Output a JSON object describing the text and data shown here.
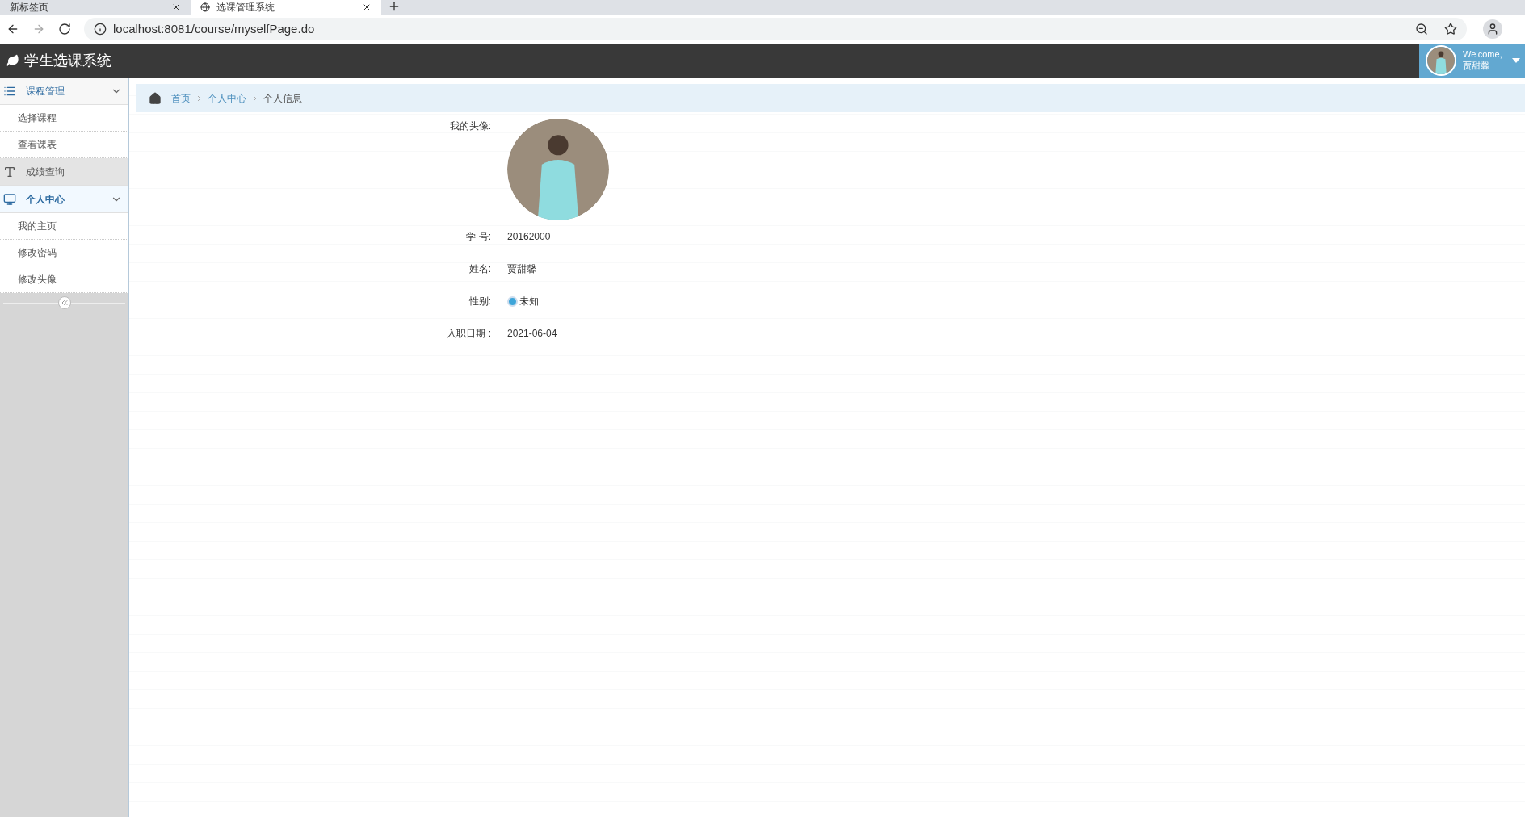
{
  "browser": {
    "tabs": [
      {
        "title": "新标签页",
        "selected": false
      },
      {
        "title": "选课管理系统",
        "selected": true
      }
    ],
    "url": "localhost:8081/course/myselfPage.do"
  },
  "header": {
    "title": "学生选课系统",
    "welcome": "Welcome,",
    "user_name": "贾甜馨"
  },
  "sidebar": {
    "items": [
      {
        "label": "课程管理",
        "kind": "list",
        "expanded": true,
        "selected": false,
        "children": [
          {
            "label": "选择课程"
          },
          {
            "label": "查看课表"
          }
        ]
      },
      {
        "label": "成绩查询",
        "kind": "text",
        "expanded": false,
        "selected": false
      },
      {
        "label": "个人中心",
        "kind": "screen",
        "expanded": true,
        "selected": true,
        "children": [
          {
            "label": "我的主页"
          },
          {
            "label": "修改密码"
          },
          {
            "label": "修改头像"
          }
        ]
      }
    ]
  },
  "breadcrumb": [
    {
      "label": "首页",
      "link": true
    },
    {
      "label": "个人中心",
      "link": true
    },
    {
      "label": "个人信息",
      "link": false
    }
  ],
  "profile": {
    "avatar_label": "我的头像:",
    "fields": [
      {
        "label": "学 号:",
        "value": "20162000",
        "kind": "text"
      },
      {
        "label": "姓名:",
        "value": "贾甜馨",
        "kind": "text"
      },
      {
        "label": "性别:",
        "value": "未知",
        "kind": "radio",
        "checked": true
      },
      {
        "label": "入职日期 :",
        "value": "2021-06-04",
        "kind": "text"
      }
    ]
  }
}
